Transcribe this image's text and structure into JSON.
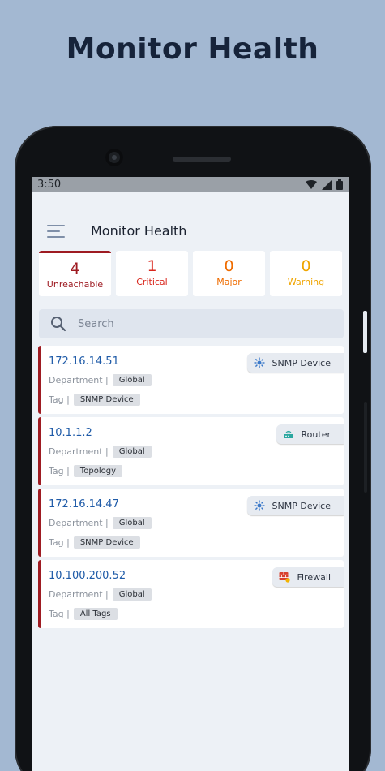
{
  "headline": "Monitor Health",
  "status_bar": {
    "time": "3:50"
  },
  "app_bar": {
    "title": "Monitor Health",
    "menu_icon": "hamburger-icon"
  },
  "summary": [
    {
      "count": "4",
      "label": "Unreachable",
      "color": "#9e1b22",
      "active": true
    },
    {
      "count": "1",
      "label": "Critical",
      "color": "#d9261c",
      "active": false
    },
    {
      "count": "0",
      "label": "Major",
      "color": "#ef6c00",
      "active": false
    },
    {
      "count": "0",
      "label": "Warning",
      "color": "#f0a500",
      "active": false
    }
  ],
  "search": {
    "placeholder": "Search",
    "icon": "search-icon"
  },
  "devices": [
    {
      "ip": "172.16.14.51",
      "type": "SNMP Device",
      "type_icon": "snmp-icon",
      "department_label": "Department |",
      "department": "Global",
      "tag_label": "Tag |",
      "tag": "SNMP Device"
    },
    {
      "ip": "10.1.1.2",
      "type": "Router",
      "type_icon": "router-icon",
      "department_label": "Department |",
      "department": "Global",
      "tag_label": "Tag |",
      "tag": "Topology"
    },
    {
      "ip": "172.16.14.47",
      "type": "SNMP Device",
      "type_icon": "snmp-icon",
      "department_label": "Department |",
      "department": "Global",
      "tag_label": "Tag |",
      "tag": "SNMP Device"
    },
    {
      "ip": "10.100.200.52",
      "type": "Firewall",
      "type_icon": "firewall-icon",
      "department_label": "Department |",
      "department": "Global",
      "tag_label": "Tag |",
      "tag": "All Tags"
    }
  ],
  "colors": {
    "unreachable_border": "#9e1b22",
    "ip_link": "#1f5ba8",
    "background": "#a3b8d2"
  }
}
